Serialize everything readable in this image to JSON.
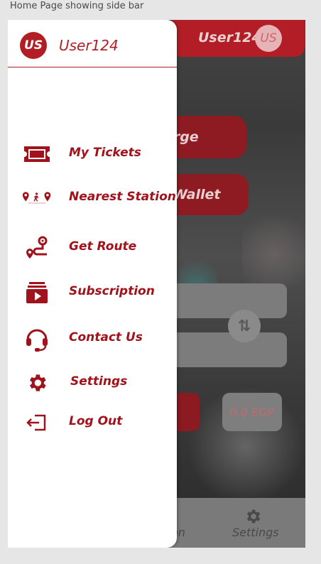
{
  "caption": "Home Page showing side bar",
  "colors": {
    "brand_red": "#b31e26",
    "menu_text": "#a0121c"
  },
  "background_screen": {
    "username": "User124",
    "avatar_initials": "US",
    "charge_label": "arge",
    "wallet_label": "Wallet",
    "swap_icon": "swap-vertical-icon",
    "price": "0.0 EGP",
    "nav_station": "on",
    "nav_settings": "Settings"
  },
  "sidebar": {
    "avatar_initials": "US",
    "username": "User124",
    "items": [
      {
        "label": "My Tickets",
        "icon": "ticket-icon"
      },
      {
        "label": "Nearest Station",
        "icon": "nearest-station-icon"
      },
      {
        "label": "Get Route",
        "icon": "route-icon"
      },
      {
        "label": "Subscription",
        "icon": "subscription-icon"
      },
      {
        "label": "Contact Us",
        "icon": "headset-icon"
      },
      {
        "label": "Settings",
        "icon": "gear-icon"
      },
      {
        "label": "Log Out",
        "icon": "logout-icon"
      }
    ]
  }
}
